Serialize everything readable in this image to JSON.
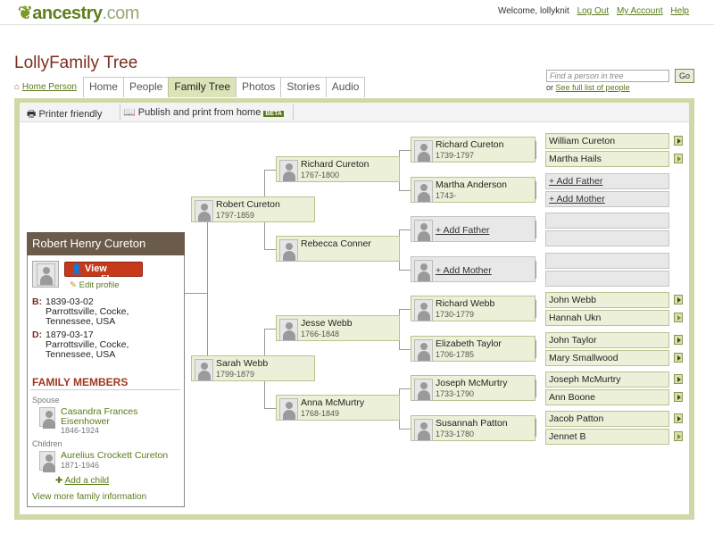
{
  "header": {
    "logo_text": "ancestry",
    "logo_suffix": ".com",
    "welcome": "Welcome, lollyknit",
    "logout": "Log Out",
    "my_account": "My Account",
    "help": "Help"
  },
  "page": {
    "title": "LollyFamily Tree",
    "home_person": "Home Person",
    "tabs": [
      "Home",
      "People",
      "Family Tree",
      "Photos",
      "Stories",
      "Audio"
    ],
    "active_tab": "Family Tree",
    "search_placeholder": "Find a person in tree",
    "go_label": "Go",
    "or_text": "or",
    "full_list_link": "See full list of people"
  },
  "toolbar": {
    "printer_friendly": "Printer friendly",
    "publish": "Publish and print from home",
    "beta": "BETA"
  },
  "tree": {
    "root": {
      "name": "Robert Henry Cureton"
    },
    "gen1": [
      {
        "name": "Robert Cureton",
        "dates": "1797-1859"
      },
      {
        "name": "Sarah Webb",
        "dates": "1799-1879"
      }
    ],
    "gen2": [
      {
        "name": "Richard Cureton",
        "dates": "1767-1800"
      },
      {
        "name": "Rebecca Conner",
        "dates": ""
      },
      {
        "name": "Jesse Webb",
        "dates": "1766-1848"
      },
      {
        "name": "Anna McMurtry",
        "dates": "1768-1849"
      }
    ],
    "gen3": [
      {
        "name": "Richard Cureton",
        "dates": "1739-1797"
      },
      {
        "name": "Martha Anderson",
        "dates": "1743-"
      },
      {
        "name": "+ Add Father",
        "dates": ""
      },
      {
        "name": "+ Add Mother",
        "dates": ""
      },
      {
        "name": "Richard Webb",
        "dates": "1730-1779"
      },
      {
        "name": "Elizabeth Taylor",
        "dates": "1706-1785"
      },
      {
        "name": "Joseph McMurtry",
        "dates": "1733-1790"
      },
      {
        "name": "Susannah Patton",
        "dates": "1733-1780"
      }
    ],
    "gen4": [
      "William Cureton",
      "Martha Hails",
      "+ Add Father",
      "+ Add Mother",
      "",
      "",
      "",
      "",
      "John Webb",
      "Hannah Ukn",
      "John Taylor",
      "Mary Smallwood",
      "Joseph McMurtry",
      "Ann Boone",
      "Jacob Patton",
      "Jennet B"
    ]
  },
  "profile": {
    "name": "Robert Henry Cureton",
    "view_profile": "View profile",
    "edit_profile": "Edit profile",
    "birth_label": "B:",
    "birth_date": "1839-03-02",
    "birth_place": "Parrottsville, Cocke, Tennessee, USA",
    "death_label": "D:",
    "death_date": "1879-03-17",
    "death_place": "Parrottsville, Cocke, Tennessee, USA",
    "family_members": "FAMILY MEMBERS",
    "spouse_label": "Spouse",
    "spouse_name": "Casandra Frances Eisenhower",
    "spouse_dates": "1846-1924",
    "children_label": "Children",
    "child_name": "Aurelius Crockett Cureton",
    "child_dates": "1871-1946",
    "add_child": "Add a child",
    "view_more": "View more family information"
  }
}
